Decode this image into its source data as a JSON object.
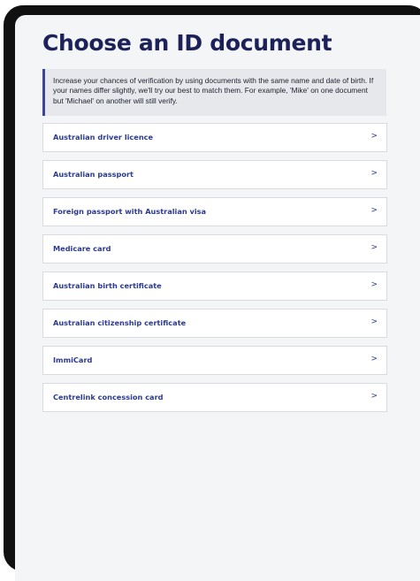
{
  "page": {
    "title": "Choose an ID document",
    "notice": "Increase your chances of verification by using documents with the same name and date of birth. If your names differ slightly, we'll try our best to match them. For example, 'Mike' on one document but 'Michael' on another will still verify."
  },
  "documents": [
    {
      "label": "Australian driver licence",
      "icon": "chevron-right-icon",
      "glyph": ">"
    },
    {
      "label": "Australian passport",
      "icon": "chevron-right-icon",
      "glyph": ">"
    },
    {
      "label": "Foreign passport with Australian visa",
      "icon": "chevron-right-icon",
      "glyph": ">"
    },
    {
      "label": "Medicare card",
      "icon": "chevron-right-icon",
      "glyph": ">"
    },
    {
      "label": "Australian birth certificate",
      "icon": "chevron-right-icon",
      "glyph": ">"
    },
    {
      "label": "Australian citizenship certificate",
      "icon": "chevron-right-icon",
      "glyph": ">"
    },
    {
      "label": "ImmiCard",
      "icon": "chevron-right-icon",
      "glyph": ">"
    },
    {
      "label": "Centrelink concession card",
      "icon": "chevron-right-icon",
      "glyph": ">"
    }
  ],
  "colors": {
    "title": "#1c2259",
    "accent": "#2c3a8f",
    "notice_border": "#3b4696",
    "notice_bg": "#e6e8ec"
  }
}
